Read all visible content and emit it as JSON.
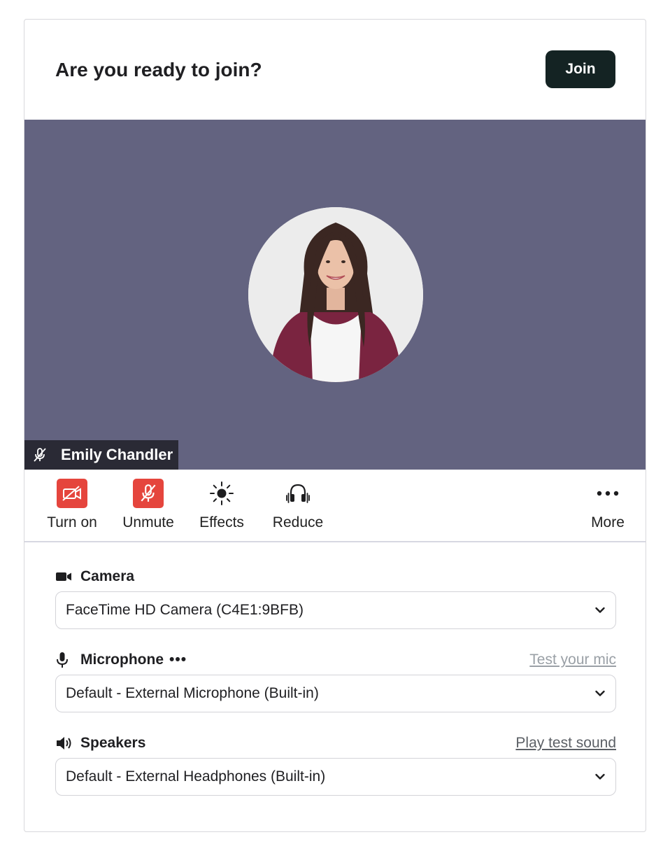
{
  "header": {
    "title": "Are you ready to join?",
    "join_label": "Join"
  },
  "preview": {
    "participant_name": "Emily Chandler",
    "background_color": "#636380"
  },
  "controls": [
    {
      "label": "Turn on",
      "icon": "video-off-icon"
    },
    {
      "label": "Unmute",
      "icon": "mic-off-icon"
    },
    {
      "label": "Effects",
      "icon": "sun-icon"
    },
    {
      "label": "Reduce",
      "icon": "headphones-icon"
    },
    {
      "label": "More",
      "icon": "more-dots-icon"
    }
  ],
  "settings": {
    "camera": {
      "label": "Camera",
      "value": "FaceTime HD Camera (C4E1:9BFB)"
    },
    "microphone": {
      "label": "Microphone",
      "more": "•••",
      "link": "Test your mic",
      "value": "Default - External Microphone (Built-in)"
    },
    "speakers": {
      "label": "Speakers",
      "link": "Play test sound",
      "value": "Default - External Headphones (Built-in)"
    }
  },
  "colors": {
    "join_button": "#142323",
    "alert_red": "#e5453d",
    "name_tag": "#2a2a35"
  }
}
